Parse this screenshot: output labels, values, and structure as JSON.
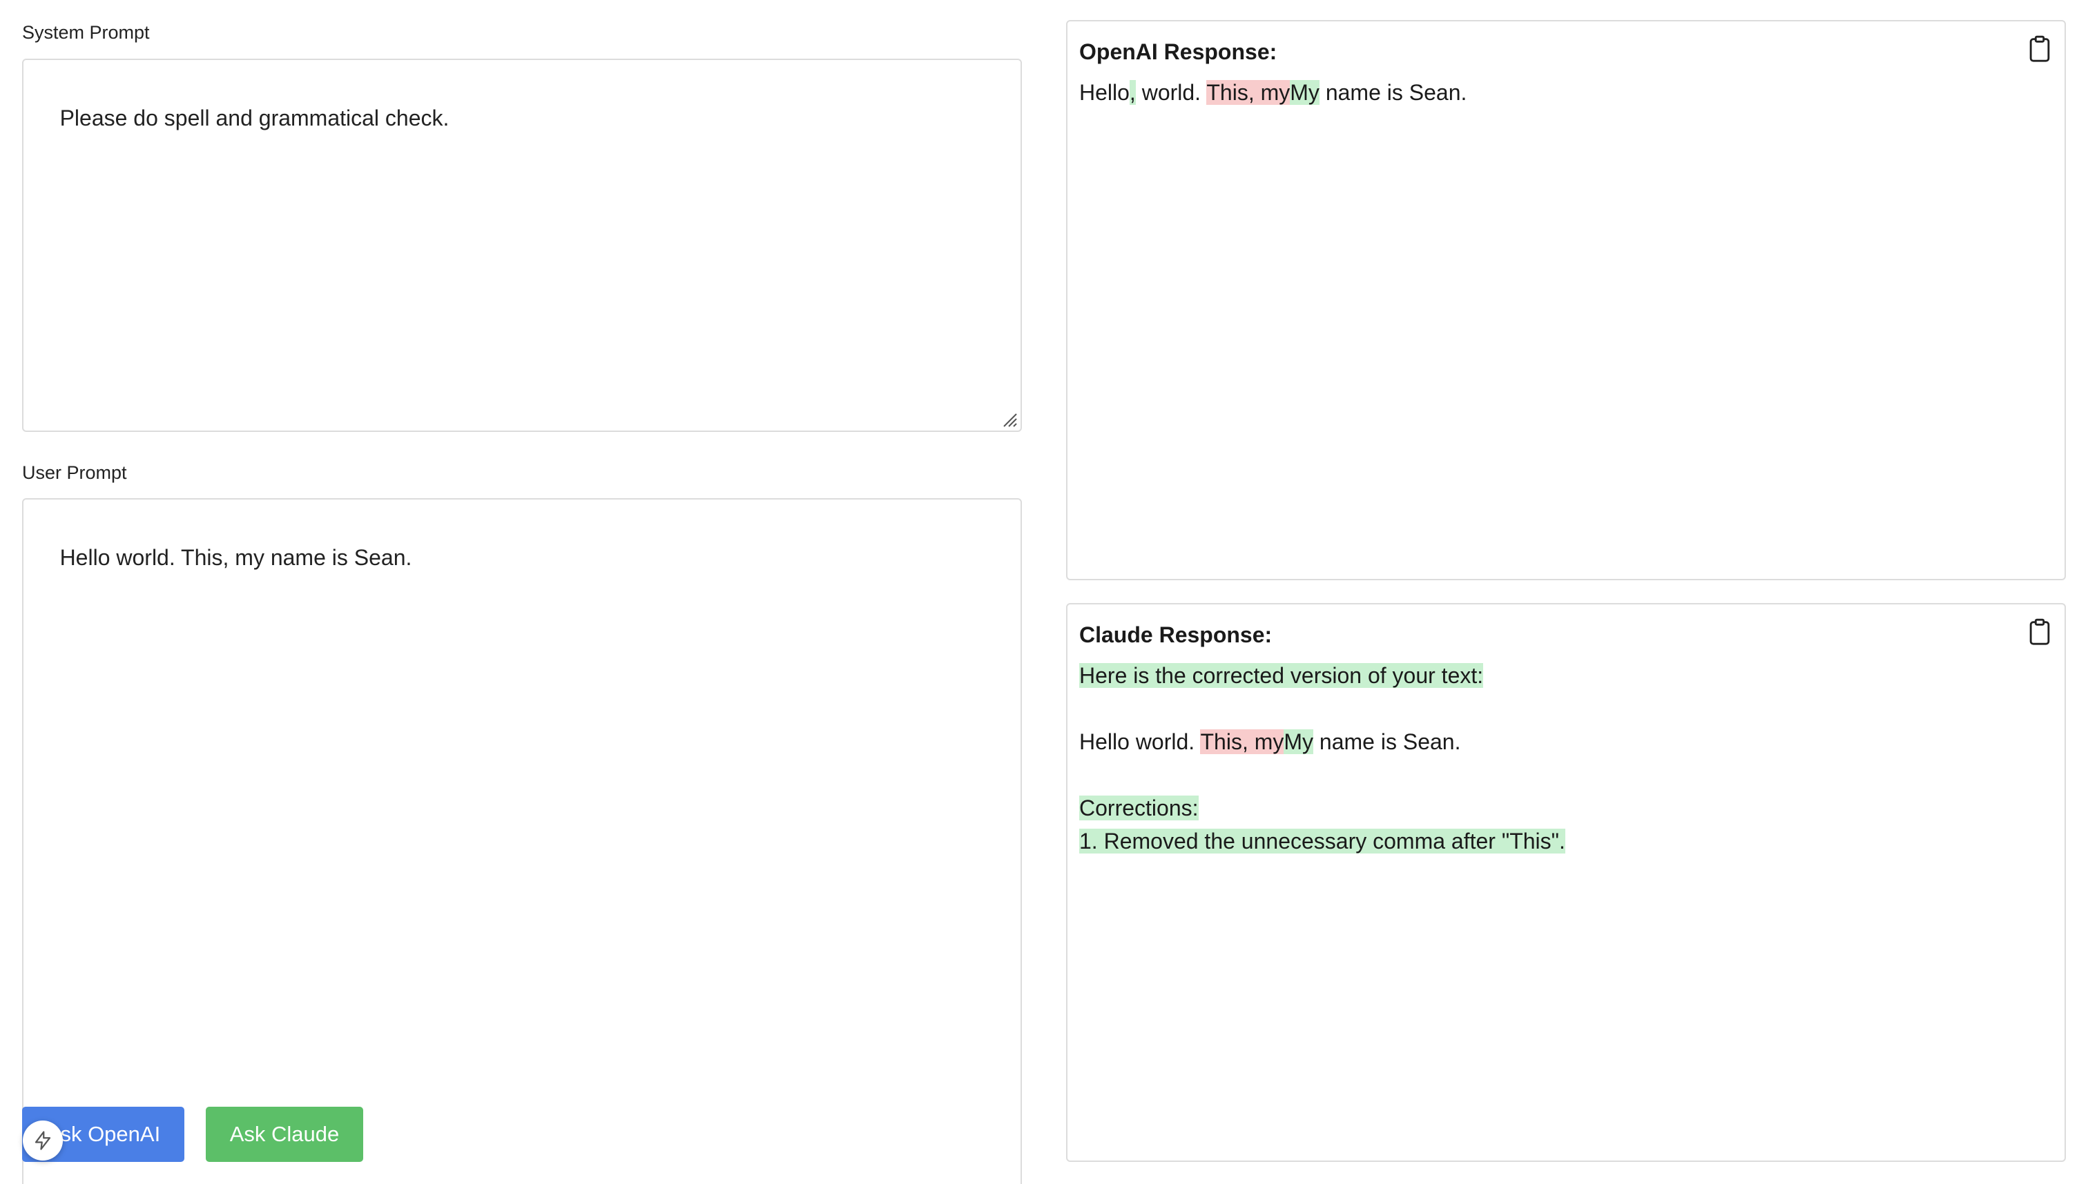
{
  "system_prompt": {
    "label": "System Prompt",
    "value": "Please do spell and grammatical check."
  },
  "user_prompt": {
    "label": "User Prompt",
    "value": "Hello world. This, my name is Sean."
  },
  "buttons": {
    "ask_openai": "Ask OpenAI",
    "ask_claude": "Ask Claude"
  },
  "openai_response": {
    "title": "OpenAI Response:",
    "lines": [
      [
        {
          "text": "Hello",
          "type": "same"
        },
        {
          "text": ",",
          "type": "ins"
        },
        {
          "text": " world. ",
          "type": "same"
        },
        {
          "text": "This, my",
          "type": "del"
        },
        {
          "text": "My",
          "type": "ins"
        },
        {
          "text": " name is Sean.",
          "type": "same"
        }
      ]
    ]
  },
  "claude_response": {
    "title": "Claude Response:",
    "lines": [
      [
        {
          "text": "Here is the corrected version of your text:",
          "type": "ins"
        }
      ],
      [],
      [
        {
          "text": "Hello world. ",
          "type": "same"
        },
        {
          "text": "This, my",
          "type": "del"
        },
        {
          "text": "My",
          "type": "ins"
        },
        {
          "text": " name is Sean.",
          "type": "same"
        }
      ],
      [],
      [
        {
          "text": "Corrections:",
          "type": "ins"
        }
      ],
      [
        {
          "text": "1. Removed the unnecessary comma after \"This\".",
          "type": "ins"
        }
      ]
    ]
  },
  "colors": {
    "insert_highlight": "#c8f0d0",
    "delete_highlight": "#f8cccc",
    "openai_button": "#4a7fe6",
    "claude_button": "#5cbf68"
  },
  "icons": {
    "copy": "clipboard-icon",
    "floating": "lightning-icon",
    "resize": "resize-grip-icon"
  }
}
